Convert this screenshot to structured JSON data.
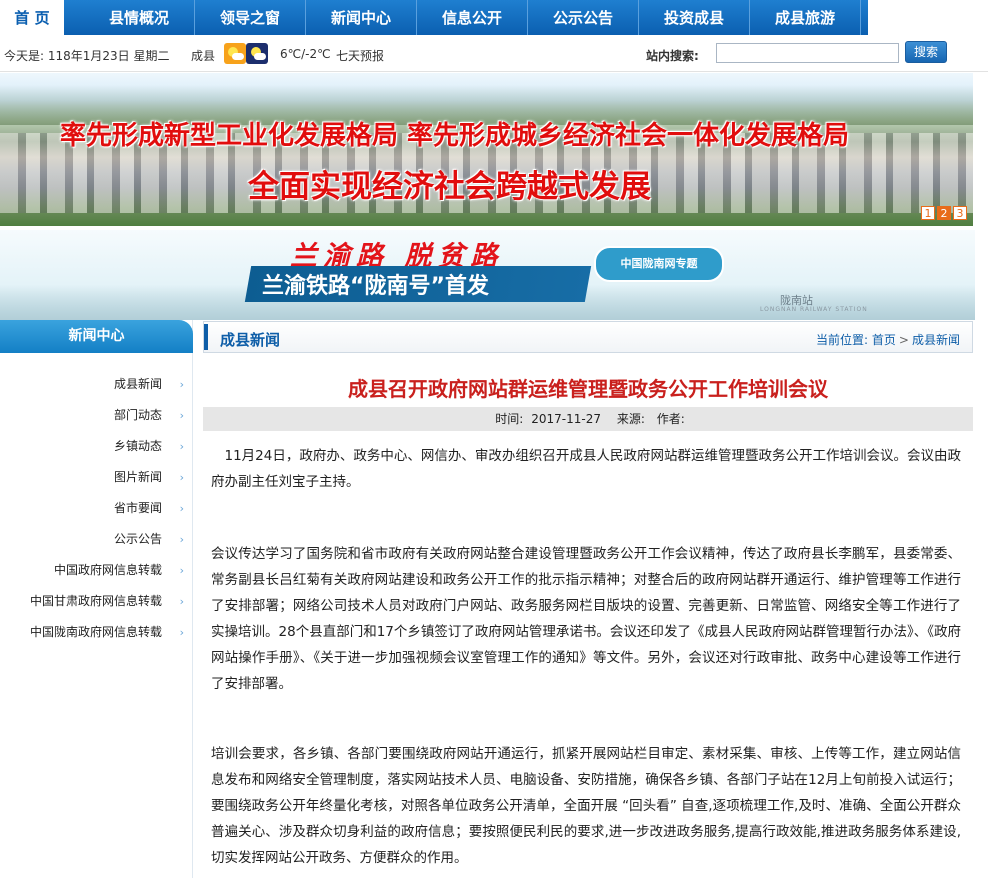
{
  "nav": {
    "items": [
      "首 页",
      "县情概况",
      "领导之窗",
      "新闻中心",
      "信息公开",
      "公示公告",
      "投资成县",
      "成县旅游"
    ]
  },
  "info": {
    "date": "今天是:  118年1月23日  星期二",
    "city": "成县",
    "weather_icons": [
      "sunny-cloudy-icon",
      "night-cloudy-icon"
    ],
    "temperature": "6℃/-2℃",
    "forecast_link": "七天预报",
    "search_label": "站内搜索:",
    "search_value": "",
    "search_button": "搜索"
  },
  "banner1": {
    "slogan_line1": "率先形成新型工业化发展格局   率先形成城乡经济社会一体化发展格局",
    "slogan_line2": "全面实现经济社会跨越式发展",
    "pages": [
      "1",
      "2",
      "3"
    ],
    "current_page": "2"
  },
  "banner2": {
    "script_text": "兰渝路 脱贫路",
    "headline": "兰渝铁路“陇南号”首发",
    "special_tag": "中国陇南网专题",
    "station_name": "陇南站",
    "station_en": "LONGNAN RAILWAY STATION"
  },
  "sidebar": {
    "title": "新闻中心",
    "items": [
      "成县新闻",
      "部门动态",
      "乡镇动态",
      "图片新闻",
      "省市要闻",
      "公示公告",
      "中国政府网信息转载",
      "中国甘肃政府网信息转载",
      "中国陇南政府网信息转载"
    ]
  },
  "crumb": {
    "section_title": "成县新闻",
    "location_label": "当前位置:",
    "home": "首页",
    "current": "成县新闻",
    "separator": ">"
  },
  "article": {
    "title": "成县召开政府网站群运维管理暨政务公开工作培训会议",
    "time_label": "时间:",
    "time_value": "2017-11-27",
    "source_label": "来源:",
    "author_label": "作者:",
    "paragraphs": [
      "　11月24日，政府办、政务中心、网信办、审改办组织召开成县人民政府网站群运维管理暨政务公开工作培训会议。会议由政府办副主任刘宝子主持。",
      "会议传达学习了国务院和省市政府有关政府网站整合建设管理暨政务公开工作会议精神，传达了政府县长李鹏军，县委常委、常务副县长吕红菊有关政府网站建设和政务公开工作的批示指示精神；对整合后的政府网站群开通运行、维护管理等工作进行了安排部署；网络公司技术人员对政府门户网站、政务服务网栏目版块的设置、完善更新、日常监管、网络安全等工作进行了实操培训。28个县直部门和17个乡镇签订了政府网站管理承诺书。会议还印发了《成县人民政府网站群管理暂行办法》、《政府网站操作手册》、《关于进一步加强视频会议室管理工作的通知》等文件。另外，会议还对行政审批、政务中心建设等工作进行了安排部署。",
      "培训会要求，各乡镇、各部门要围绕政府网站开通运行，抓紧开展网站栏目审定、素材采集、审核、上传等工作，建立网站信息发布和网络安全管理制度，落实网站技术人员、电脑设备、安防措施，确保各乡镇、各部门子站在12月上旬前投入试运行；要围绕政务公开年终量化考核，对照各单位政务公开清单，全面开展 “回头看” 自查,逐项梳理工作,及时、准确、全面公开群众普遍关心、涉及群众切身利益的政府信息；要按照便民利民的要求,进一步改进政务服务,提高行政效能,推进政务服务体系建设,切实发挥网站公开政务、方便群众的作用。"
    ]
  }
}
